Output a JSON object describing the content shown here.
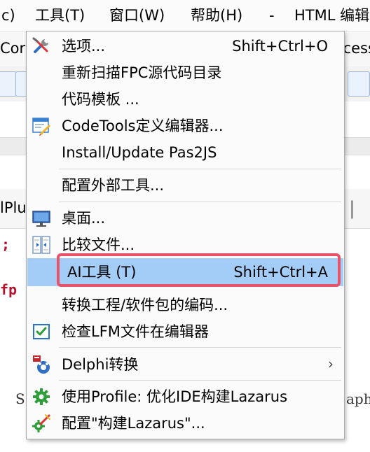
{
  "menubar": {
    "items": [
      {
        "label": "c)"
      },
      {
        "label": "工具(T)"
      },
      {
        "label": "窗口(W)"
      },
      {
        "label": "帮助(H)"
      },
      {
        "label": "-"
      },
      {
        "label": "HTML 编辑"
      }
    ]
  },
  "background": {
    "toolbar_left": "Cor",
    "toolbar_right": "ccess",
    "tab_left": "lPlu",
    "code_line1": ";",
    "code_line2": "fp",
    "code_line3_left": "S",
    "code_line3_right": "aph"
  },
  "menu": {
    "items": [
      {
        "label": "选项...",
        "shortcut": "Shift+Ctrl+O",
        "icon": "options-icon"
      },
      {
        "label": "重新扫描FPC源代码目录",
        "shortcut": ""
      },
      {
        "label": "代码模板 ...",
        "shortcut": ""
      },
      {
        "label": "CodeTools定义编辑器...",
        "shortcut": "",
        "icon": "codetools-icon"
      },
      {
        "label": "Install/Update Pas2JS",
        "shortcut": ""
      },
      {
        "label": "配置外部工具...",
        "shortcut": ""
      },
      {
        "label": "桌面...",
        "shortcut": "",
        "icon": "desktop-icon"
      },
      {
        "label": "比较文件...",
        "shortcut": "",
        "icon": "diff-icon"
      },
      {
        "label": "AI工具 (T)",
        "shortcut": "Shift+Ctrl+A",
        "highlighted": true
      },
      {
        "label": "转换工程/软件包的编码...",
        "shortcut": ""
      },
      {
        "label": "检查LFM文件在编辑器",
        "shortcut": "",
        "icon": "check-icon"
      },
      {
        "label": "Delphi转换",
        "shortcut": "",
        "icon": "delphi-icon",
        "submenu": true
      },
      {
        "label": "使用Profile: 优化IDE构建Lazarus",
        "shortcut": "",
        "icon": "gear-icon"
      },
      {
        "label": "配置\"构建Lazarus\"...",
        "shortcut": "",
        "icon": "build-config-icon"
      }
    ]
  },
  "colors": {
    "highlight": "#a3cdf7",
    "annotation_box": "#e8536a"
  }
}
